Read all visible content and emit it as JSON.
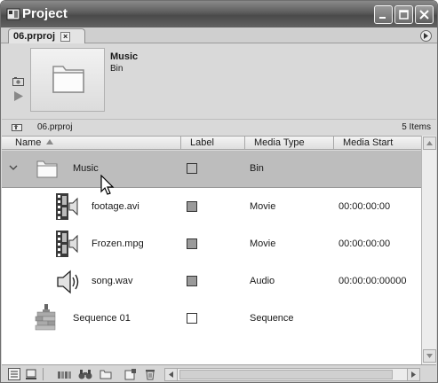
{
  "window": {
    "title": "Project"
  },
  "tab": {
    "label": "06.prproj",
    "close_glyph": "×"
  },
  "preview": {
    "name": "Music",
    "type": "Bin"
  },
  "pathbar": {
    "path": "06.prproj",
    "count": "5 Items"
  },
  "columns": {
    "name": "Name",
    "label": "Label",
    "media_type": "Media Type",
    "media_start": "Media Start"
  },
  "rows": [
    {
      "name": "Music",
      "type": "Bin",
      "start": "",
      "icon": "folder-icon",
      "label_filled": false,
      "selected": true
    },
    {
      "name": "footage.avi",
      "type": "Movie",
      "start": "00:00:00:00",
      "icon": "movie-icon",
      "label_filled": true,
      "selected": false
    },
    {
      "name": "Frozen.mpg",
      "type": "Movie",
      "start": "00:00:00:00",
      "icon": "movie-icon",
      "label_filled": true,
      "selected": false
    },
    {
      "name": "song.wav",
      "type": "Audio",
      "start": "00:00:00:00000",
      "icon": "speaker-icon",
      "label_filled": true,
      "selected": false
    },
    {
      "name": "Sequence 01",
      "type": "Sequence",
      "start": "",
      "icon": "sequence-icon",
      "label_filled": false,
      "selected": false
    }
  ],
  "colors": {
    "selected_row": "#bdbdbd",
    "titlebar": "#5b5b5b"
  }
}
